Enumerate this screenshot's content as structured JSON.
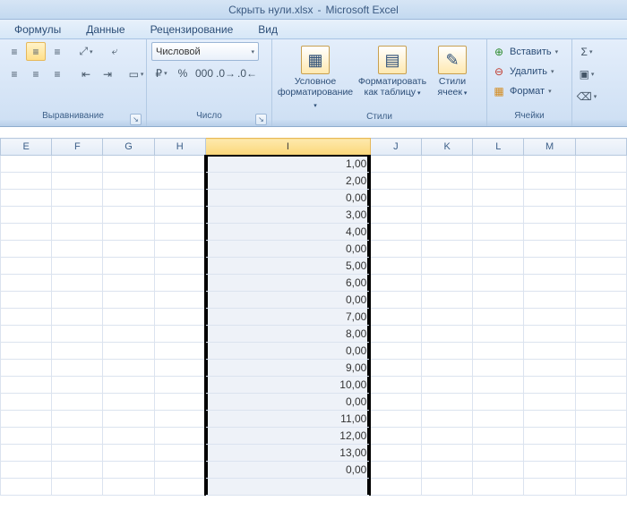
{
  "title": {
    "doc": "Скрыть нули.xlsx",
    "sep": "-",
    "app": "Microsoft Excel"
  },
  "tabs": {
    "formulas": "Формулы",
    "data": "Данные",
    "review": "Рецензирование",
    "view": "Вид"
  },
  "groups": {
    "alignment": "Выравнивание",
    "number": "Число",
    "styles": "Стили",
    "cells": "Ячейки"
  },
  "number": {
    "format_name": "Числовой",
    "percent": "%",
    "thousands": "000"
  },
  "styles": {
    "cond_fmt_1": "Условное",
    "cond_fmt_2": "форматирование",
    "fmt_table_1": "Форматировать",
    "fmt_table_2": "как таблицу",
    "cell_styles_1": "Стили",
    "cell_styles_2": "ячеек"
  },
  "cells": {
    "insert": "Вставить",
    "delete": "Удалить",
    "format": "Формат"
  },
  "columns": {
    "E": "E",
    "F": "F",
    "G": "G",
    "H": "H",
    "I": "I",
    "J": "J",
    "K": "K",
    "L": "L",
    "M": "M"
  },
  "chart_data": {
    "type": "table",
    "column": "I",
    "values": [
      "1,00",
      "2,00",
      "0,00",
      "3,00",
      "4,00",
      "0,00",
      "5,00",
      "6,00",
      "0,00",
      "7,00",
      "8,00",
      "0,00",
      "9,00",
      "10,00",
      "0,00",
      "11,00",
      "12,00",
      "13,00",
      "0,00"
    ]
  }
}
